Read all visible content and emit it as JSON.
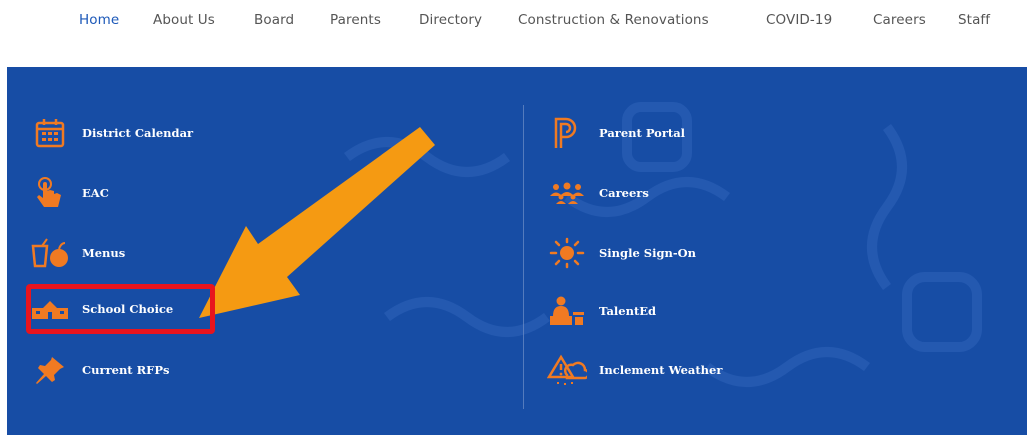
{
  "nav": {
    "items": [
      {
        "label": "Home",
        "active": true
      },
      {
        "label": "About Us"
      },
      {
        "label": "Board"
      },
      {
        "label": "Parents"
      },
      {
        "label": "Directory"
      },
      {
        "label": "Construction & Renovations"
      },
      {
        "label": "COVID-19"
      },
      {
        "label": "Careers"
      },
      {
        "label": "Staff"
      }
    ]
  },
  "panel": {
    "left_links": [
      {
        "label": "District Calendar",
        "icon": "calendar-icon"
      },
      {
        "label": "EAC",
        "icon": "touch-icon"
      },
      {
        "label": "Menus",
        "icon": "menu-food-icon"
      },
      {
        "label": "School Choice",
        "icon": "school-icon"
      },
      {
        "label": "Current RFPs",
        "icon": "pushpin-icon"
      }
    ],
    "right_links": [
      {
        "label": "Parent Portal",
        "icon": "powerschool-icon"
      },
      {
        "label": "Careers",
        "icon": "people-icon"
      },
      {
        "label": "Single Sign-On",
        "icon": "sun-icon"
      },
      {
        "label": "TalentEd",
        "icon": "desk-person-icon"
      },
      {
        "label": "Inclement Weather",
        "icon": "storm-icon"
      }
    ]
  },
  "colors": {
    "panel_bg": "#174da5",
    "icon": "#f07a22",
    "arrow": "#f59a12",
    "highlight": "#e8141e",
    "nav_active": "#1c58b8"
  }
}
